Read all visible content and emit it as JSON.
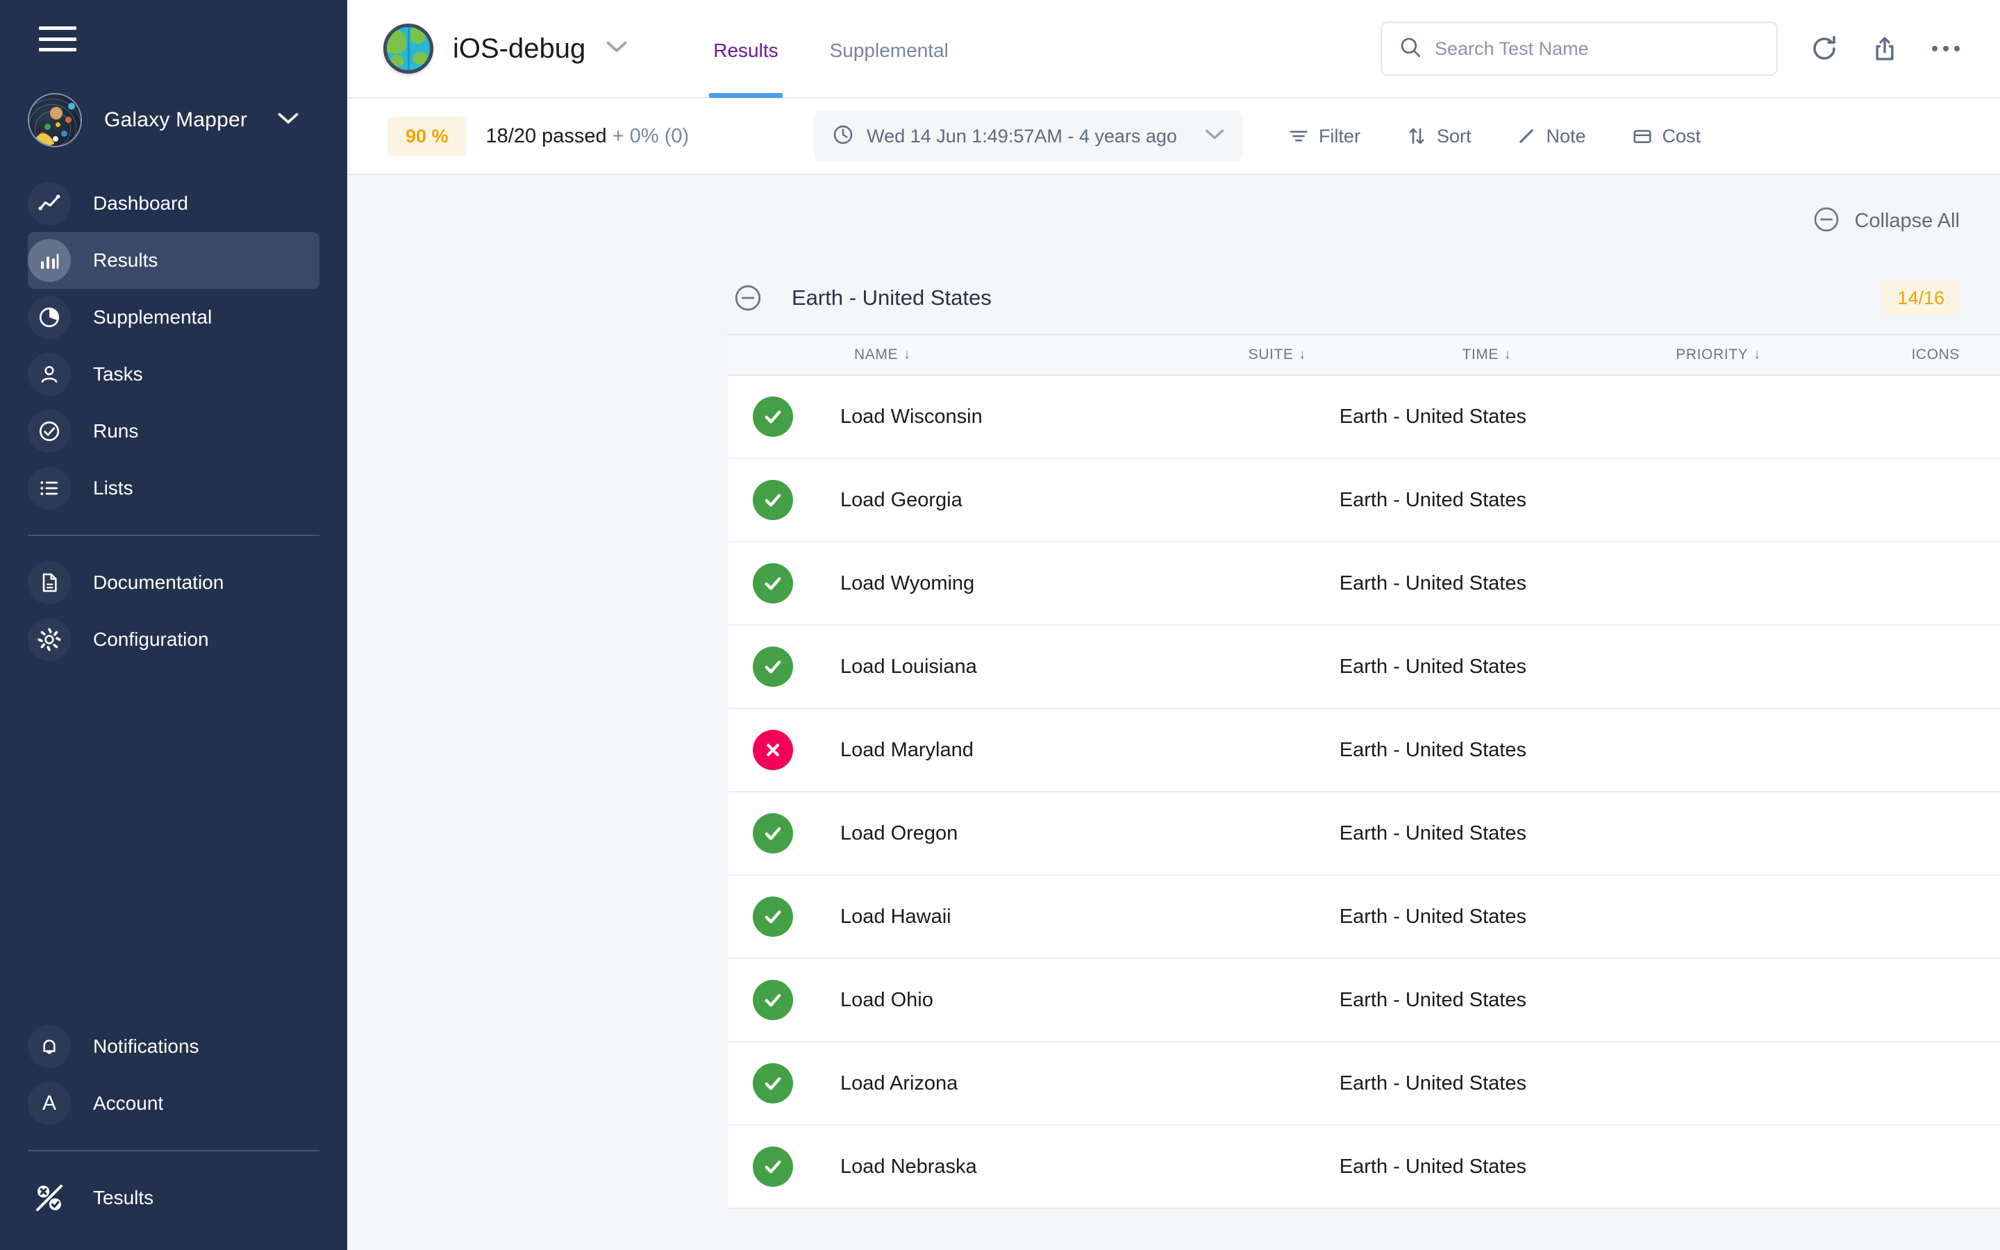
{
  "sidebar": {
    "menu_icon": "hamburger-icon",
    "workspace": {
      "name": "Galaxy Mapper",
      "avatar": "galaxy-avatar",
      "chevron": "chevron-down-icon"
    },
    "items": [
      {
        "label": "Dashboard",
        "icon": "line-chart-icon",
        "active": false
      },
      {
        "label": "Results",
        "icon": "bar-chart-icon",
        "active": true
      },
      {
        "label": "Supplemental",
        "icon": "pie-chart-icon",
        "active": false
      },
      {
        "label": "Tasks",
        "icon": "person-icon",
        "active": false
      },
      {
        "label": "Runs",
        "icon": "check-circle-icon",
        "active": false
      },
      {
        "label": "Lists",
        "icon": "list-icon",
        "active": false
      }
    ],
    "items_secondary": [
      {
        "label": "Documentation",
        "icon": "document-icon"
      },
      {
        "label": "Configuration",
        "icon": "gear-icon"
      }
    ],
    "items_bottom": [
      {
        "label": "Notifications",
        "icon": "bell-icon"
      },
      {
        "label": "Account",
        "icon": "avatar-letter-a"
      }
    ],
    "brand": {
      "label": "Tesults",
      "icon": "tesults-percent-logo"
    }
  },
  "header": {
    "project": {
      "name": "iOS-debug",
      "icon": "globe-icon",
      "chevron": "chevron-down-icon"
    },
    "tabs": [
      {
        "label": "Results",
        "active": true
      },
      {
        "label": "Supplemental",
        "active": false
      }
    ],
    "search": {
      "placeholder": "Search Test Name",
      "value": "",
      "icon": "search-icon"
    },
    "actions": [
      {
        "name": "refresh-icon"
      },
      {
        "name": "share-icon"
      },
      {
        "name": "more-options-icon"
      }
    ]
  },
  "toolbar": {
    "pass_percent": "90 %",
    "pass_summary": "18/20 passed",
    "pass_delta": " + 0% (0)",
    "run_date": "Wed 14 Jun 1:49:57AM - 4 years ago",
    "run_date_icon": "clock-icon",
    "run_date_chevron": "chevron-down-icon",
    "actions": [
      {
        "label": "Filter",
        "icon": "filter-icon"
      },
      {
        "label": "Sort",
        "icon": "sort-arrows-icon"
      },
      {
        "label": "Note",
        "icon": "pencil-icon"
      },
      {
        "label": "Cost",
        "icon": "card-icon"
      }
    ]
  },
  "content": {
    "collapse_all": {
      "label": "Collapse All",
      "icon": "minus-circle-icon"
    },
    "group": {
      "title": "Earth - United States",
      "count": "14/16",
      "toggle_icon": "minus-circle-icon"
    },
    "columns": [
      {
        "key": "name",
        "label": "NAME",
        "sort": "↓"
      },
      {
        "key": "suite",
        "label": "SUITE",
        "sort": "↓"
      },
      {
        "key": "time",
        "label": "TIME",
        "sort": "↓"
      },
      {
        "key": "priority",
        "label": "PRIORITY",
        "sort": "↓"
      },
      {
        "key": "icons",
        "label": "ICONS",
        "sort": ""
      }
    ],
    "rows": [
      {
        "status": "pass",
        "name": "Load Wisconsin",
        "suite": "Earth - United States",
        "time": "",
        "priority": "",
        "icons": ""
      },
      {
        "status": "pass",
        "name": "Load Georgia",
        "suite": "Earth - United States",
        "time": "",
        "priority": "",
        "icons": ""
      },
      {
        "status": "pass",
        "name": "Load Wyoming",
        "suite": "Earth - United States",
        "time": "",
        "priority": "",
        "icons": ""
      },
      {
        "status": "pass",
        "name": "Load Louisiana",
        "suite": "Earth - United States",
        "time": "",
        "priority": "",
        "icons": ""
      },
      {
        "status": "fail",
        "name": "Load Maryland",
        "suite": "Earth - United States",
        "time": "",
        "priority": "",
        "icons": ""
      },
      {
        "status": "pass",
        "name": "Load Oregon",
        "suite": "Earth - United States",
        "time": "",
        "priority": "",
        "icons": ""
      },
      {
        "status": "pass",
        "name": "Load Hawaii",
        "suite": "Earth - United States",
        "time": "",
        "priority": "",
        "icons": ""
      },
      {
        "status": "pass",
        "name": "Load Ohio",
        "suite": "Earth - United States",
        "time": "",
        "priority": "",
        "icons": ""
      },
      {
        "status": "pass",
        "name": "Load Arizona",
        "suite": "Earth - United States",
        "time": "",
        "priority": "",
        "icons": ""
      },
      {
        "status": "pass",
        "name": "Load Nebraska",
        "suite": "Earth - United States",
        "time": "",
        "priority": "",
        "icons": ""
      }
    ]
  },
  "colors": {
    "sidebar_bg": "#22314e",
    "accent_tab": "#6a1b9a",
    "tab_underline": "#4a9ce8",
    "pass_green": "#43a047",
    "fail_red": "#f50057",
    "warn_amber": "#f0a500",
    "warn_amber_bg": "#fdf4e3",
    "page_bg": "#f4f6f9"
  }
}
